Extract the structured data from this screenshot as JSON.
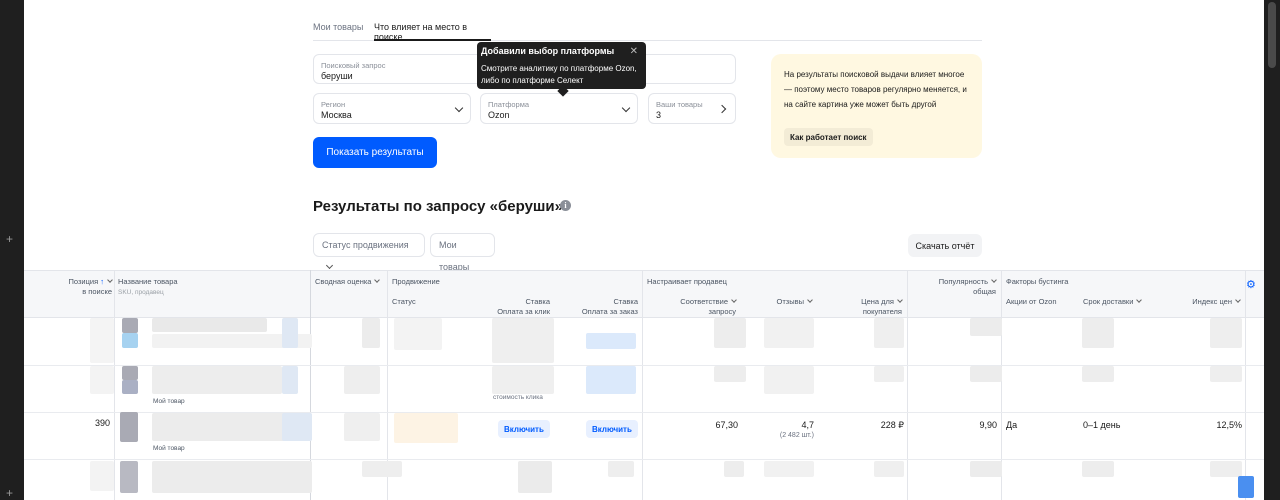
{
  "tabs": [
    {
      "label": "Мои товары",
      "active": false
    },
    {
      "label": "Что влияет на место в поиске",
      "active": true
    }
  ],
  "form": {
    "query_label": "Поисковый запрос",
    "query_value": "беруши",
    "region_label": "Регион",
    "region_value": "Москва",
    "platform_label": "Платформа",
    "platform_value": "Ozon",
    "your_items_label": "Ваши товары",
    "your_items_value": "3",
    "submit_label": "Показать результаты"
  },
  "tooltip": {
    "title": "Добавили выбор платформы",
    "text": "Смотрите аналитику по платформе Ozon, либо по платформе Селект"
  },
  "info": {
    "text": "На результаты поисковой выдачи влияет многое — поэтому место товаров регулярно меняется, и на сайте картина уже может быть другой",
    "button": "Как работает поиск"
  },
  "results": {
    "title": "Результаты по запросу «беруши»",
    "filter_status": "Статус продвижения",
    "filter_my": "Мои товары",
    "download": "Скачать отчёт"
  },
  "table": {
    "headers": {
      "position": "Позиция",
      "position_sub": "в поиске",
      "name": "Название товара",
      "name_sub": "SKU, продавец",
      "summary": "Сводная оценка",
      "promo": "Продвижение",
      "status": "Статус",
      "rate_click_1": "Ставка",
      "rate_click_2": "Оплата за клик",
      "rate_order_1": "Ставка",
      "rate_order_2": "Оплата за заказ",
      "seller": "Настраивает продавец",
      "relevance_1": "Соответствие",
      "relevance_2": "запросу",
      "reviews": "Отзывы",
      "price_1": "Цена для",
      "price_2": "покупателя",
      "popularity_1": "Популярность",
      "popularity_2": "общая",
      "boost": "Факторы бустинга",
      "ozon_promo": "Акции от Ozon",
      "delivery": "Срок доставки",
      "price_index": "Индекс цен"
    },
    "my_item_label": "Мой товар",
    "click_cost_label": "стоимость клика",
    "row": {
      "position": "390",
      "enable_click": "Включить",
      "enable_order": "Включить",
      "relevance": "67,30",
      "reviews": "4,7",
      "reviews_count": "(2 482 шт.)",
      "price": "228 ₽",
      "popularity": "9,90",
      "ozon_promo": "Да",
      "delivery": "0–1 день",
      "price_index": "12,5%"
    }
  },
  "colors": {
    "accent": "#005bff",
    "info_bg": "#fff8e1",
    "tooltip_bg": "#1f1f1f"
  }
}
